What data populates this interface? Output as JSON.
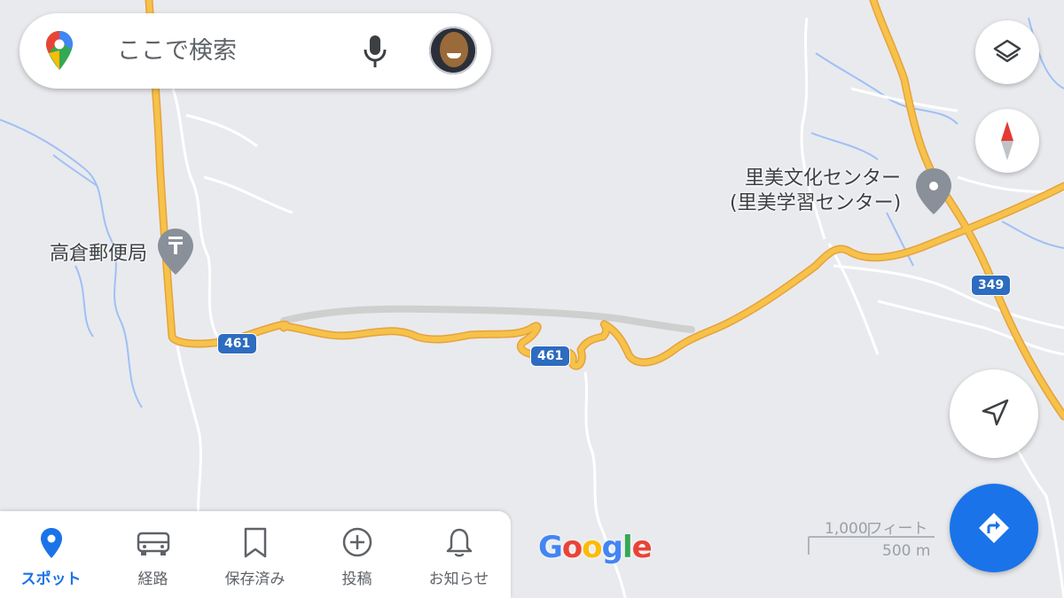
{
  "search": {
    "placeholder": "ここで検索"
  },
  "map": {
    "pois": [
      {
        "name": "高倉郵便局",
        "type": "post-office"
      },
      {
        "name_line1": "里美文化センター",
        "name_line2": "(里美学習センター)",
        "type": "place"
      }
    ],
    "route_shields": [
      "461",
      "461",
      "349"
    ],
    "google_logo": "Google",
    "scale": {
      "imperial": "1,000フィート",
      "metric": "500 m"
    }
  },
  "bottom_nav": {
    "items": [
      {
        "label": "スポット",
        "icon": "map-pin-icon",
        "active": true
      },
      {
        "label": "経路",
        "icon": "car-icon",
        "active": false
      },
      {
        "label": "保存済み",
        "icon": "bookmark-icon",
        "active": false
      },
      {
        "label": "投稿",
        "icon": "add-circle-icon",
        "active": false
      },
      {
        "label": "お知らせ",
        "icon": "bell-icon",
        "active": false
      }
    ]
  },
  "colors": {
    "accent": "#1a73e8",
    "road_yellow": "#f6c24a",
    "road_outline": "#e6a23c",
    "water": "#8ab4f8",
    "shield_blue": "#2d6cc0",
    "map_background": "#e9eaee"
  }
}
